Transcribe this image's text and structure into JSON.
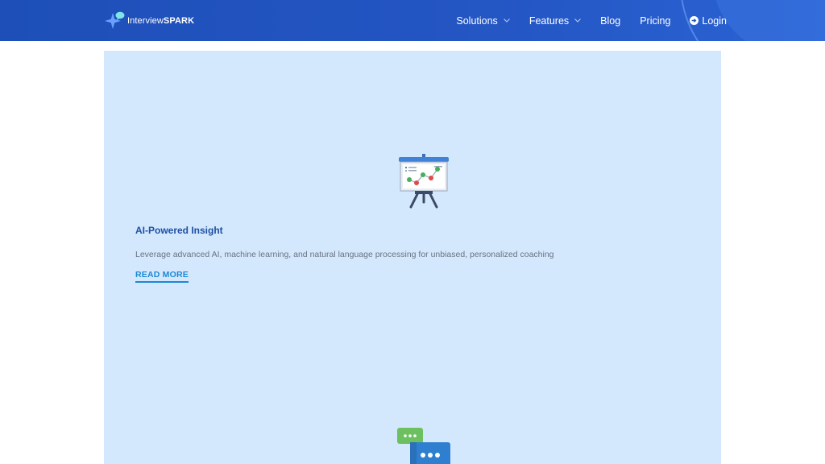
{
  "header": {
    "logo": {
      "prefix": "Interview",
      "bold": "SPARK"
    },
    "nav": [
      {
        "label": "Solutions",
        "dropdown": true
      },
      {
        "label": "Features",
        "dropdown": true
      },
      {
        "label": "Blog",
        "dropdown": false
      },
      {
        "label": "Pricing",
        "dropdown": false
      }
    ],
    "login_label": "Login"
  },
  "feature": {
    "icon": "presentation-chart-icon",
    "title": "AI-Powered Insight",
    "description": "Leverage advanced AI, machine learning, and natural language processing for unbiased, personalized coaching",
    "cta": "READ MORE"
  },
  "next_feature": {
    "icon": "chat-bubbles-icon"
  },
  "colors": {
    "header_bg": "#2456c4",
    "panel_bg": "#d4e8fd",
    "title": "#1d4fa3",
    "link": "#1b87d6"
  }
}
